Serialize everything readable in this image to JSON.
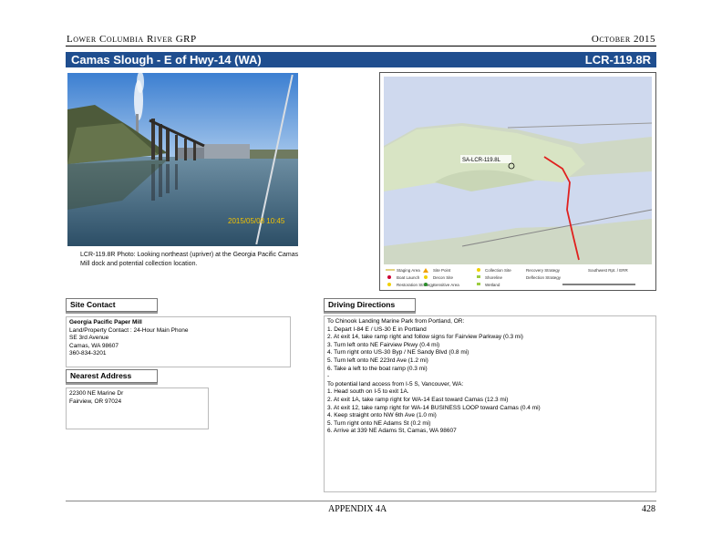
{
  "header": {
    "left": "Lower Columbia River GRP",
    "right": "October 2015"
  },
  "title": {
    "site_name": "Camas Slough - E of Hwy-14 (WA)",
    "site_code": "LCR-119.8R"
  },
  "photo": {
    "timestamp": "2015/05/08 10:45",
    "caption": "LCR-119.8R Photo: Looking northeast (upriver) at the Georgia Pacific Camas Mill dock and potential collection location."
  },
  "map": {
    "site_label": "SA-LCR-119.8L",
    "legend": [
      "Staging Area",
      "Boat Launch",
      "Restoration Strategy",
      "Site Point",
      "Decon Site",
      "Sensitive Area",
      "Collection Site",
      "Shoreline",
      "Wetland",
      "Recovery Strategy",
      "Deflection Strategy"
    ],
    "source": "Southwest Rpt. / ERR"
  },
  "site_contact": {
    "heading": "Site Contact",
    "org": "Georgia Pacific Paper Mill",
    "lines": [
      "Land/Property Contact : 24-Hour Main Phone",
      "SE 3rd Avenue",
      "Camas, WA 98607",
      "360-834-3201"
    ]
  },
  "nearest_address": {
    "heading": "Nearest Address",
    "lines": [
      "22300 NE Marine Dr",
      "Fairview, OR 97024"
    ]
  },
  "driving_directions": {
    "heading": "Driving Directions",
    "lines": [
      "To Chinook Landing Marine Park from Portland, OR:",
      "1. Depart I-84 E / US-30 E in Portland",
      "2. At exit 14, take ramp right and follow signs for Fairview Parkway (0.3 mi)",
      "3. Turn left onto NE Fairview Pkwy (0.4 mi)",
      "4. Turn right onto US-30 Byp / NE Sandy Blvd (0.8 mi)",
      "5. Turn left onto NE 223rd Ave (1.2 mi)",
      "6. Take a left to the boat ramp (0.3 mi)",
      "-",
      "To potential land access from I-5 S, Vancouver, WA:",
      "1. Head south on I-5 to exit 1A.",
      "2. At exit 1A, take ramp right for WA-14 East toward Camas (12.3 mi)",
      "3. At exit 12, take ramp right for WA-14 BUSINESS LOOP toward Camas (0.4 mi)",
      "4. Keep straight onto NW 6th Ave (1.0 mi)",
      "5. Turn right onto NE Adams St (0.2 mi)",
      "6. Arrive at 339 NE Adams St, Camas, WA 98607"
    ]
  },
  "footer": {
    "center": "APPENDIX 4A",
    "page": "428"
  }
}
